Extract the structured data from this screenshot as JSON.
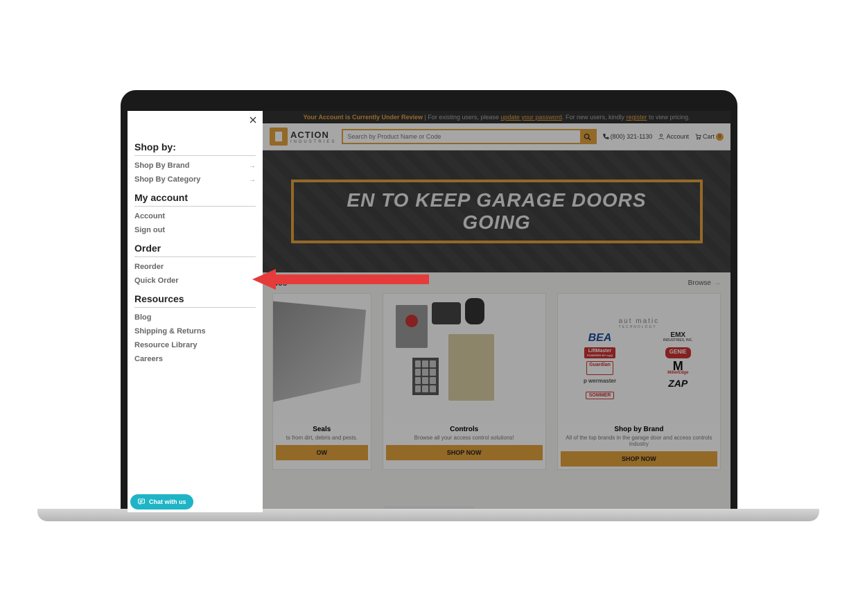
{
  "sidebar": {
    "section_shop": "Shop by:",
    "shop_brand": "Shop By Brand",
    "shop_category": "Shop By Category",
    "section_account": "My account",
    "account_link": "Account",
    "signout_link": "Sign out",
    "section_order": "Order",
    "reorder": "Reorder",
    "quickorder": "Quick Order",
    "section_resources": "Resources",
    "blog": "Blog",
    "shipping": "Shipping & Returns",
    "library": "Resource Library",
    "careers": "Careers"
  },
  "notice": {
    "review": "Your Account is Currently Under Review",
    "mid1": " | For existing users, please ",
    "link1": "update your password",
    "mid2": ". For new users, kindly ",
    "link2": "register",
    "tail": " to view pricing."
  },
  "header": {
    "brand_top": "ACTION",
    "brand_sub": "INDUSTRIES",
    "search_placeholder": "Search by Product Name or Code",
    "phone": "(800) 321-1130",
    "account": "Account",
    "cart": "Cart",
    "cart_count": "0"
  },
  "hero": {
    "text": "EN TO KEEP GARAGE DOORS GOING"
  },
  "categories": {
    "section_title": "ries",
    "browse": "Browse",
    "card1": {
      "title": "Seals",
      "sub": "ts from dirt, debris and pests.",
      "btn": "OW"
    },
    "card2": {
      "title": "Controls",
      "sub": "Browse all your access control solutions!",
      "btn": "SHOP NOW"
    },
    "card3": {
      "title": "Shop by Brand",
      "sub": "All of the top brands in the garage door and access controls industry",
      "btn": "SHOP NOW"
    }
  },
  "brands": {
    "auto": "aut matic",
    "auto_sub": "TECHNOLOGY",
    "bea": "BEA",
    "emx": "EMX",
    "emx_sub": "INDUSTRIES, INC.",
    "lift": "LiftMaster",
    "lift_sub": "POWERED BY myQ",
    "genie": "GENIE",
    "guardian": "Guardian",
    "miller": "MillerEdge",
    "pm": "p wermaster",
    "zap": "ZAP",
    "sommer": "SOMMER"
  },
  "chat": {
    "label": "Chat with us"
  }
}
